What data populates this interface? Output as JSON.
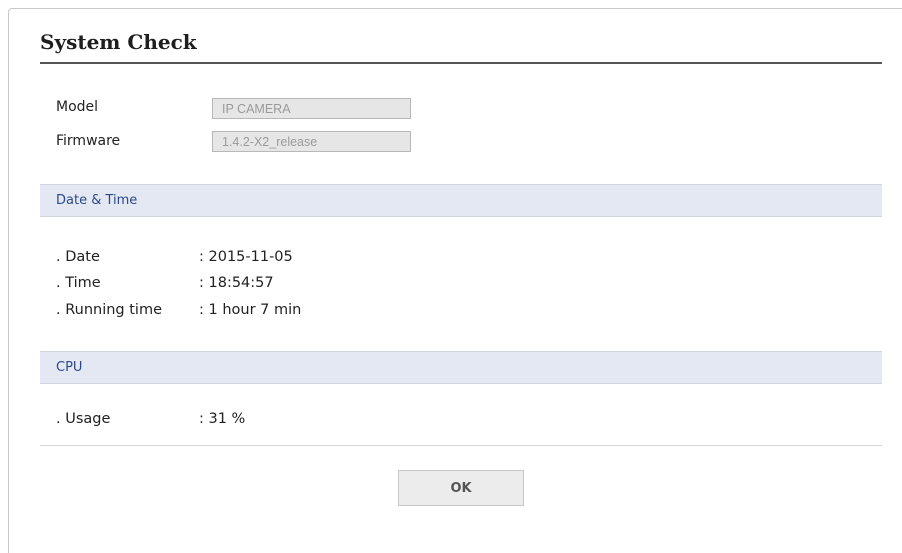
{
  "header": {
    "title": "System Check"
  },
  "info": {
    "model_label": "Model",
    "model_value": "IP CAMERA",
    "firmware_label": "Firmware",
    "firmware_value": "1.4.2-X2_release"
  },
  "date_time": {
    "section_title": "Date & Time",
    "rows": [
      {
        "label": ". Date",
        "value": ": 2015-11-05"
      },
      {
        "label": ". Time",
        "value": ": 18:54:57"
      },
      {
        "label": ". Running time",
        "value": ": 1 hour 7 min"
      }
    ]
  },
  "cpu": {
    "section_title": "CPU",
    "rows": [
      {
        "label": ". Usage",
        "value": ": 31 %"
      }
    ]
  },
  "footer": {
    "ok_label": "OK"
  }
}
